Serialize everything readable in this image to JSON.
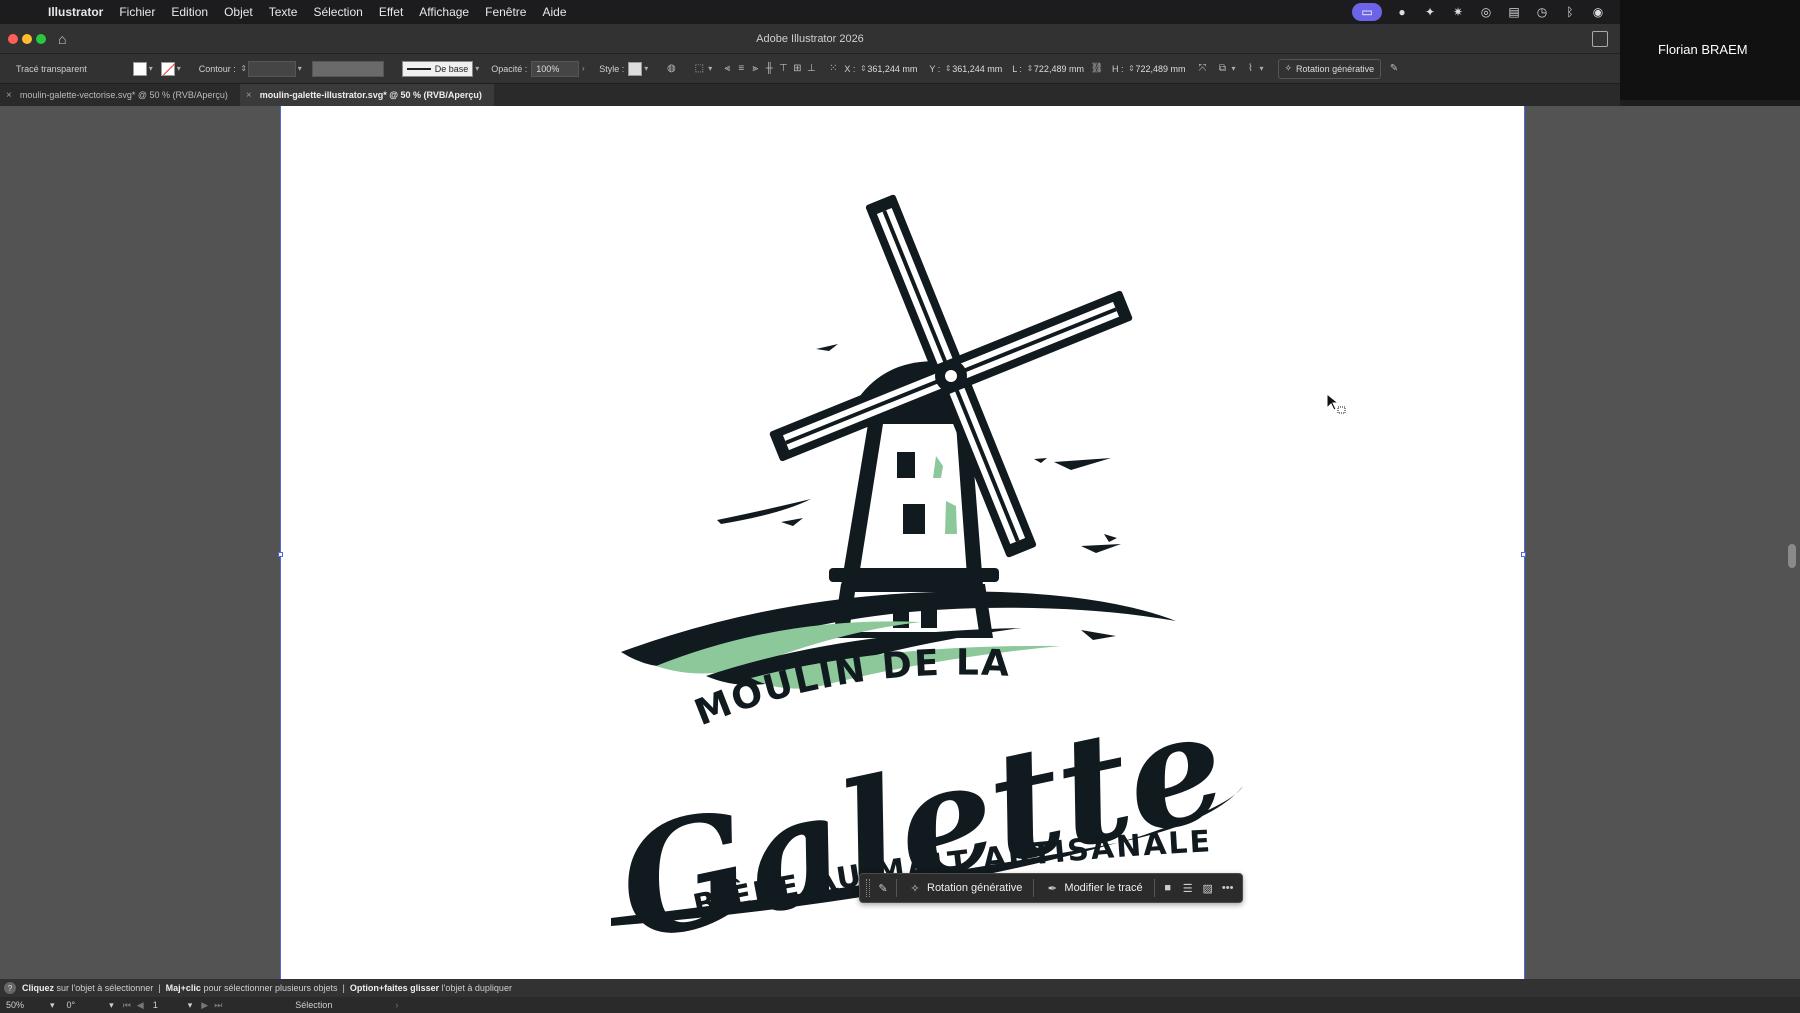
{
  "menubar": {
    "app_name": "Illustrator",
    "items": [
      "Fichier",
      "Edition",
      "Objet",
      "Texte",
      "Sélection",
      "Effet",
      "Affichage",
      "Fenêtre",
      "Aide"
    ]
  },
  "user": {
    "name": "Florian BRAEM"
  },
  "window": {
    "title": "Adobe Illustrator 2026"
  },
  "control_bar": {
    "object_type": "Tracé transparent",
    "stroke_label": "Contour :",
    "stroke_profile": "De base",
    "opacity_label": "Opacité :",
    "opacity_value": "100%",
    "style_label": "Style :",
    "x_label": "X :",
    "x_value": "361,244 mm",
    "y_label": "Y :",
    "y_value": "361,244 mm",
    "w_label": "L :",
    "w_value": "722,489 mm",
    "h_label": "H :",
    "h_value": "722,489 mm",
    "generative_button": "Rotation générative"
  },
  "tabs": [
    {
      "label": "moulin-galette-vectorise.svg* @ 50 % (RVB/Aperçu)",
      "active": false
    },
    {
      "label": "moulin-galette-illustrator.svg* @ 50 % (RVB/Aperçu)",
      "active": true
    }
  ],
  "artwork": {
    "line1": "MOULIN DE LA",
    "script": "Galette",
    "line3": "BIÈRE AU MALT ARTISANALE",
    "colors": {
      "ink": "#111a1e",
      "accent_green": "#8dc89a",
      "white": "#ffffff"
    }
  },
  "task_bar": {
    "generative_button": "Rotation générative",
    "edit_path_button": "Modifier le tracé"
  },
  "hint_bar": {
    "click": "Cliquez",
    "click_rest": "sur l'objet à sélectionner",
    "shift": "Maj+clic",
    "shift_rest": "pour sélectionner plusieurs objets",
    "option": "Option+faites glisser",
    "option_rest": "l'objet à dupliquer"
  },
  "bottom_bar": {
    "zoom": "50%",
    "rotation": "0°",
    "artboard_number": "1",
    "tool": "Sélection"
  }
}
